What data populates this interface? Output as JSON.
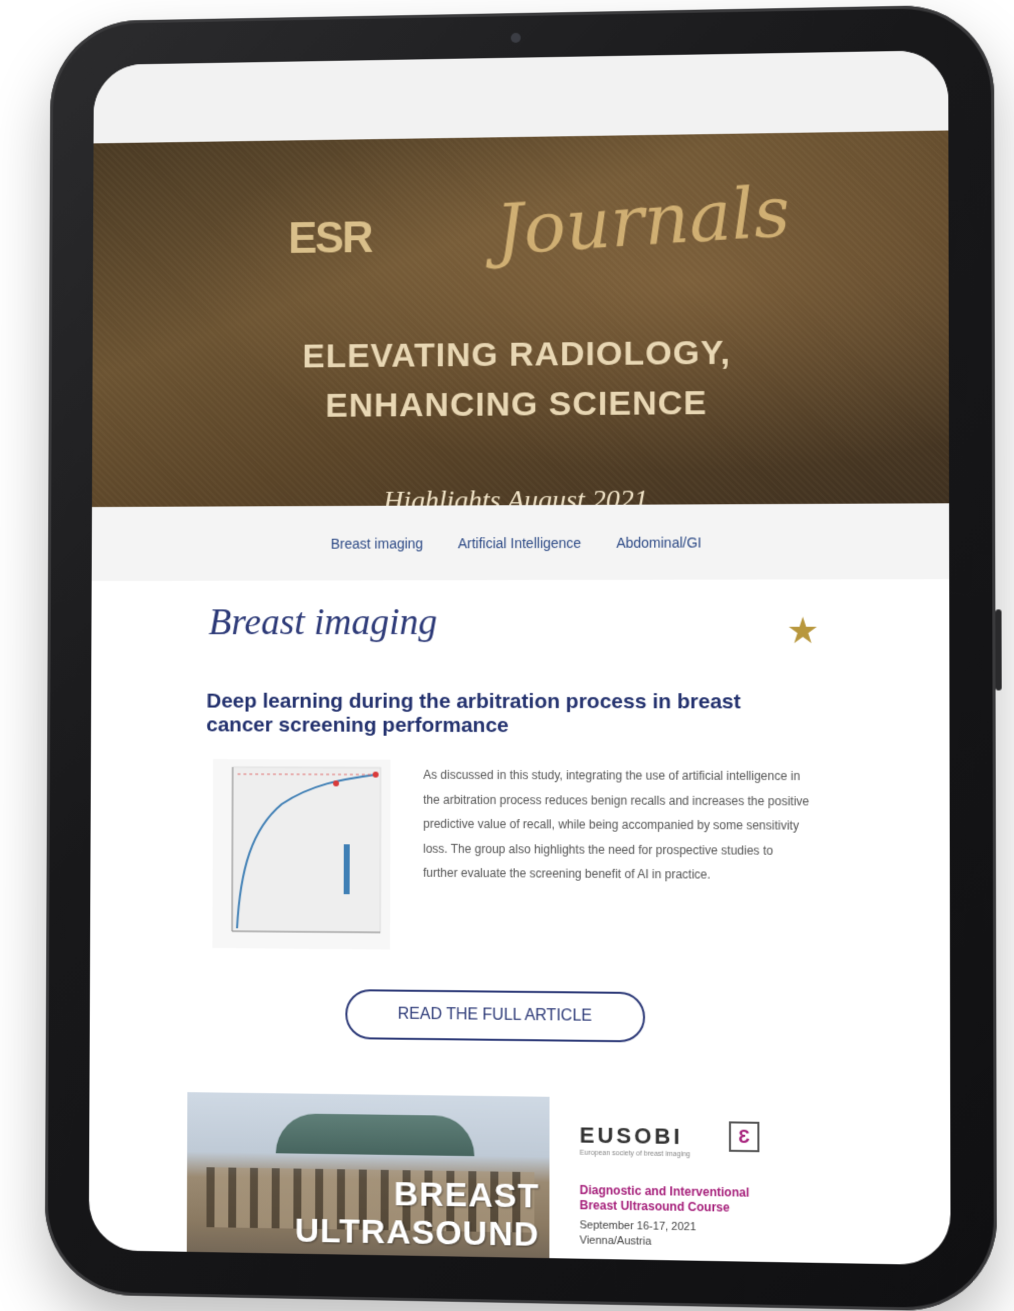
{
  "header": {
    "logo_prefix": "ESR",
    "logo_script": "Journals",
    "headline_line1": "ELEVATING RADIOLOGY,",
    "headline_line2": "ENHANCING SCIENCE",
    "subtitle": "Highlights August 2021"
  },
  "nav": {
    "items": [
      {
        "label": "Breast imaging"
      },
      {
        "label": "Artificial Intelligence"
      },
      {
        "label": "Abdominal/GI"
      }
    ]
  },
  "section": {
    "title": "Breast imaging",
    "star_icon": "star-icon"
  },
  "article": {
    "title": "Deep learning during the arbitration process in breast cancer screening performance",
    "body": "As discussed in this study, integrating the use of artificial intelligence in the arbitration process reduces benign recalls and increases the positive predictive value of recall, while being accompanied by some sensitivity loss. The group also highlights the need for prospective studies to further evaluate the screening benefit of AI in practice.",
    "cta": "READ THE FULL ARTICLE"
  },
  "banner": {
    "photo_word1": "BREAST",
    "photo_word2": "ULTRASOUND",
    "org": "EUSOBI",
    "org_tagline": "European society of breast imaging",
    "course_title": "Diagnostic and Interventional Breast Ultrasound Course",
    "dates": "September 16-17, 2021",
    "location": "Vienna/Austria"
  },
  "colors": {
    "brand_navy": "#2d3a78",
    "gold": "#b8973d",
    "magenta": "#a6207b"
  }
}
